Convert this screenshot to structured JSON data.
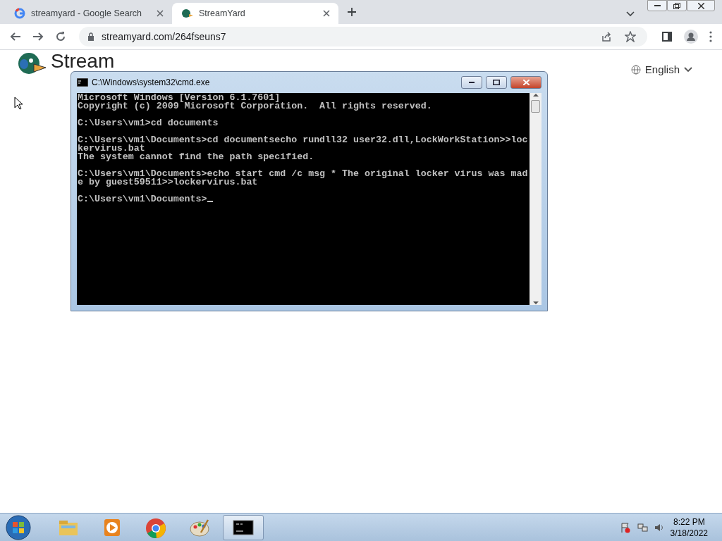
{
  "browser": {
    "tabs": [
      {
        "label": "streamyard - Google Search",
        "selected": false
      },
      {
        "label": "StreamYard",
        "selected": true
      }
    ],
    "address": "streamyard.com/264fseuns7"
  },
  "page": {
    "logo": "Stream",
    "language": "English"
  },
  "console_window": {
    "title": "C:\\Windows\\system32\\cmd.exe",
    "blocks": [
      [
        "Microsoft Windows [Version 6.1.7601]",
        "Copyright (c) 2009 Microsoft Corporation.  All rights reserved."
      ],
      [
        "C:\\Users\\vm1>cd documents"
      ],
      [
        "C:\\Users\\vm1\\Documents>cd documentsecho rundll32 user32.dll,LockWorkStation>>loc",
        "kervirus.bat",
        "The system cannot find the path specified."
      ],
      [
        "C:\\Users\\vm1\\Documents>echo start cmd /c msg * The original locker virus was mad",
        "e by guest59511>>lockervirus.bat"
      ],
      [
        "C:\\Users\\vm1\\Documents>"
      ]
    ]
  },
  "taskbar": {
    "apps": [
      {
        "kind": "explorer",
        "selected": false
      },
      {
        "kind": "media",
        "selected": false
      },
      {
        "kind": "chrome",
        "selected": false
      },
      {
        "kind": "paint",
        "selected": false
      },
      {
        "kind": "console",
        "selected": true
      }
    ],
    "clock": {
      "time": "8:22 PM",
      "date": "3/18/2022"
    }
  }
}
